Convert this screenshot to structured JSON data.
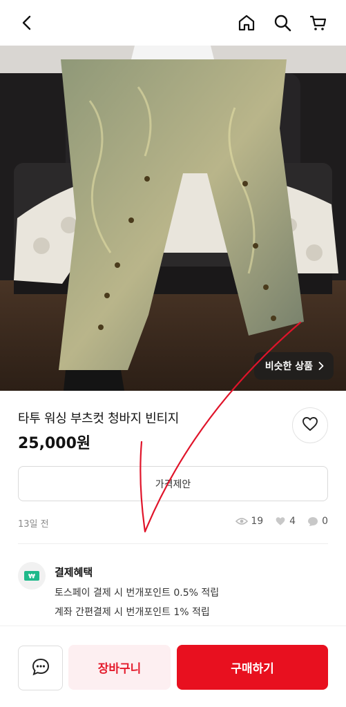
{
  "header": {
    "back_icon": "back-arrow-icon",
    "home_icon": "home-icon",
    "search_icon": "search-icon",
    "cart_icon": "cart-icon"
  },
  "product": {
    "image_subject": "washed vintage bootcut jeans photo",
    "similar_label": "비슷한 상품",
    "title": "타투 워싱 부츠컷 청바지 빈티지",
    "price": "25,000원",
    "offer_label": "가격제안",
    "posted": "13일 전",
    "views": "19",
    "likes": "4",
    "chats": "0"
  },
  "benefits": {
    "title": "결제혜택",
    "lines": [
      "토스페이 결제 시 번개포인트 0.5% 적립",
      "계좌 간편결제 시 번개포인트 1% 적립"
    ]
  },
  "bottom": {
    "cart_label": "장바구니",
    "buy_label": "구매하기"
  },
  "colors": {
    "accent": "#e8101f",
    "cart_bg": "#fdeff1",
    "annotation_stroke": "#e0142a"
  }
}
